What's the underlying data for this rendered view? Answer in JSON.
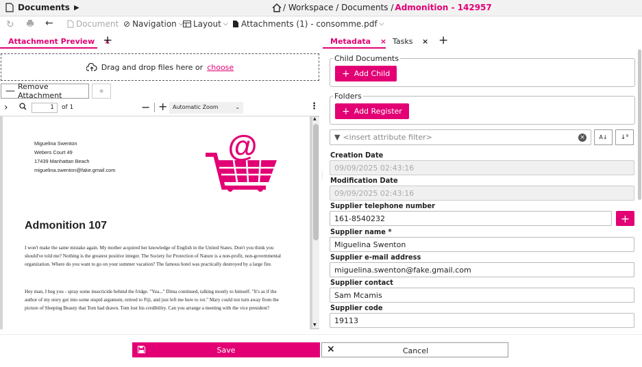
{
  "header": {
    "doc_menu": "Documents",
    "breadcrumb_prefix": "/ Workspace / Documents / ",
    "breadcrumb_current": "Admonition - 142957"
  },
  "toolbar": {
    "document": "Document",
    "navigation": "Navigation",
    "layout": "Layout",
    "attachments": "Attachments (1) - consomme.pdf"
  },
  "left_tabs": [
    {
      "label": "Attachment Preview"
    }
  ],
  "dropzone": {
    "text": "Drag and drop files here or",
    "link": "choose"
  },
  "remove_attachment": "Remove Attachment",
  "pdf": {
    "page": "1",
    "of": "of 1",
    "zoom": "Automatic Zoom",
    "address": [
      "Miguelina Swenton",
      "Webers Court 49",
      "17439 Manhattan Beach",
      "miguelina.swenton@fake.gmail.com"
    ],
    "heading": "Admonition 107",
    "para1": "I won't make the same mistake again. My mother acquired her knowledge of English in the United States. Don't you think you should've told me? Nothing is the greatest positive integer. The Society for Protection of Nature is a non-profit, non-governmental organization. Where do you want to go on your summer vacation? The famous hotel was practically destroyed by a large fire.",
    "para2": "Hey man, I beg you - spray some insecticide behind the fridge. \"Yea...\" Dima continued, talking mostly to himself. \"It's as if the author of my story got into some stupid argument, retired to Fiji, and just left me here to rot.\" Mary could not turn away from the picture of Sleeping Beauty that Tom had drawn. Tom lost his credibility. Can you arrange a meeting with the vice president?"
  },
  "right_tabs": [
    {
      "label": "Metadata"
    },
    {
      "label": "Tasks"
    }
  ],
  "child_documents": {
    "legend": "Child Documents",
    "button": "Add Child"
  },
  "folders": {
    "legend": "Folders",
    "button": "Add Register"
  },
  "filter": {
    "placeholder": "<insert attribute filter>"
  },
  "fields": {
    "creation_date": {
      "label": "Creation Date",
      "value": "09/09/2025 02:43:16"
    },
    "modification_date": {
      "label": "Modification Date",
      "value": "09/09/2025 02:43:16"
    },
    "supplier_phone": {
      "label": "Supplier telephone number",
      "value": "161-8540232"
    },
    "supplier_name": {
      "label": "Supplier name *",
      "value": "Miguelina Swenton"
    },
    "supplier_email": {
      "label": "Supplier e-mail address",
      "value": "miguelina.swenton@fake.gmail.com"
    },
    "supplier_contact": {
      "label": "Supplier contact",
      "value": "Sam Mcamis"
    },
    "supplier_code": {
      "label": "Supplier code",
      "value": "19113"
    }
  },
  "footer": {
    "save": "Save",
    "cancel": "Cancel"
  },
  "colors": {
    "accent": "#e20074"
  }
}
